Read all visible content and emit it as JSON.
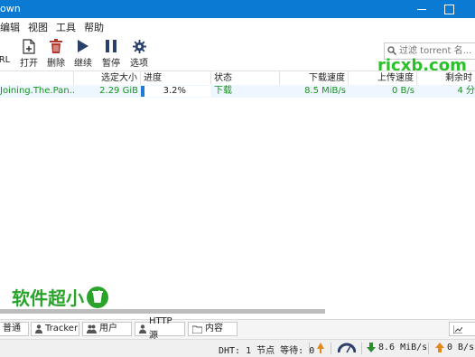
{
  "window": {
    "title_fragment": "own"
  },
  "menu": [
    "编辑",
    "视图",
    "工具",
    "帮助"
  ],
  "toolbar": [
    {
      "label": "RL",
      "icon": "add-link-icon"
    },
    {
      "label": "打开",
      "icon": "open-file-icon"
    },
    {
      "label": "删除",
      "icon": "delete-icon"
    },
    {
      "label": "继续",
      "icon": "resume-icon"
    },
    {
      "label": "暂停",
      "icon": "pause-icon"
    },
    {
      "label": "选项",
      "icon": "gear-icon"
    }
  ],
  "search": {
    "placeholder": "过滤 torrent 名..."
  },
  "table": {
    "columns": [
      "选定大小",
      "进度",
      "状态",
      "下载速度",
      "上传速度",
      "剩余时"
    ],
    "rows": [
      {
        "name": "Joining.The.Pan...",
        "size": "2.29 GiB",
        "progress": "3.2%",
        "progress_value": 0.032,
        "status": "下载",
        "down": "8.5 MiB/s",
        "up": "0 B/s",
        "eta": "4 分"
      }
    ]
  },
  "watermark": {
    "top": "rjcxb.com",
    "bottom": "软件超小"
  },
  "tabs": [
    "普通",
    "Tracker",
    "用户",
    "HTTP 源",
    "内容"
  ],
  "status": {
    "dht": "DHT: 1 节点 等待: 0",
    "down": "8.6 MiB/s",
    "up": "0 B/s"
  },
  "colors": {
    "titlebar": "#0a7ad2",
    "accent": "#1e7ad6",
    "green": "#18901e"
  }
}
